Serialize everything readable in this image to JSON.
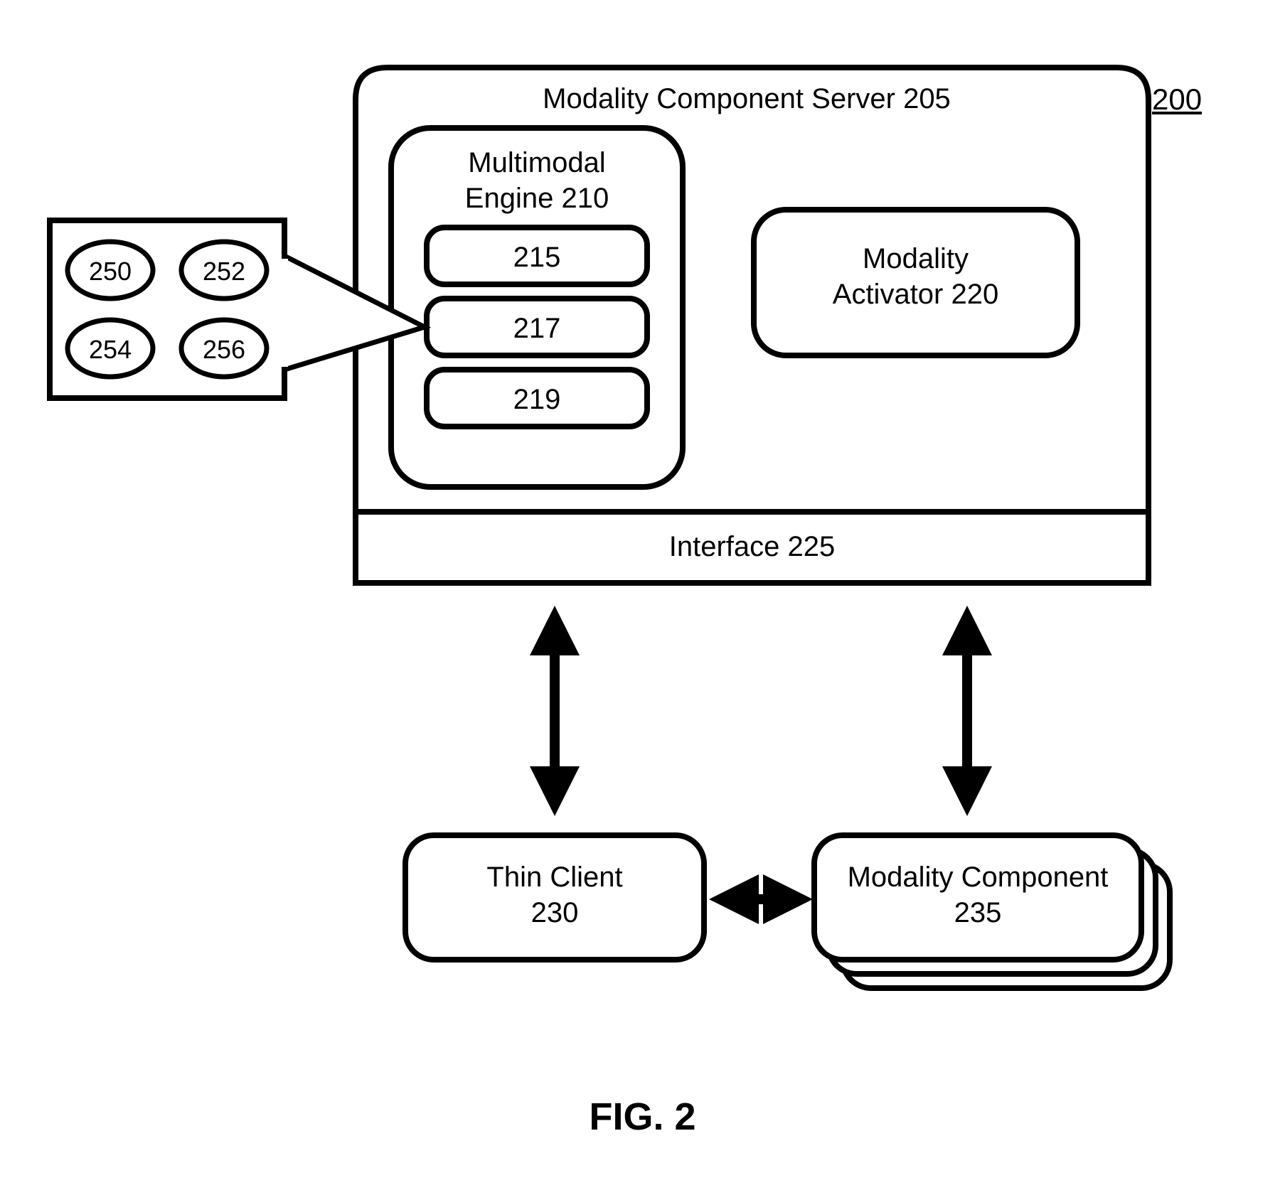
{
  "figure_number": "200",
  "caption": "FIG. 2",
  "server": {
    "label": "Modality Component Server 205",
    "engine": {
      "title_line1": "Multimodal",
      "title_line2": "Engine 210",
      "block_a": "215",
      "block_b": "217",
      "block_c": "219"
    },
    "activator": {
      "line1": "Modality",
      "line2": "Activator 220"
    },
    "interface_label": "Interface 225"
  },
  "callout": {
    "a": "250",
    "b": "252",
    "c": "254",
    "d": "256"
  },
  "thin_client": {
    "line1": "Thin Client",
    "line2": "230"
  },
  "modality_component": {
    "line1": "Modality Component",
    "line2": "235"
  }
}
